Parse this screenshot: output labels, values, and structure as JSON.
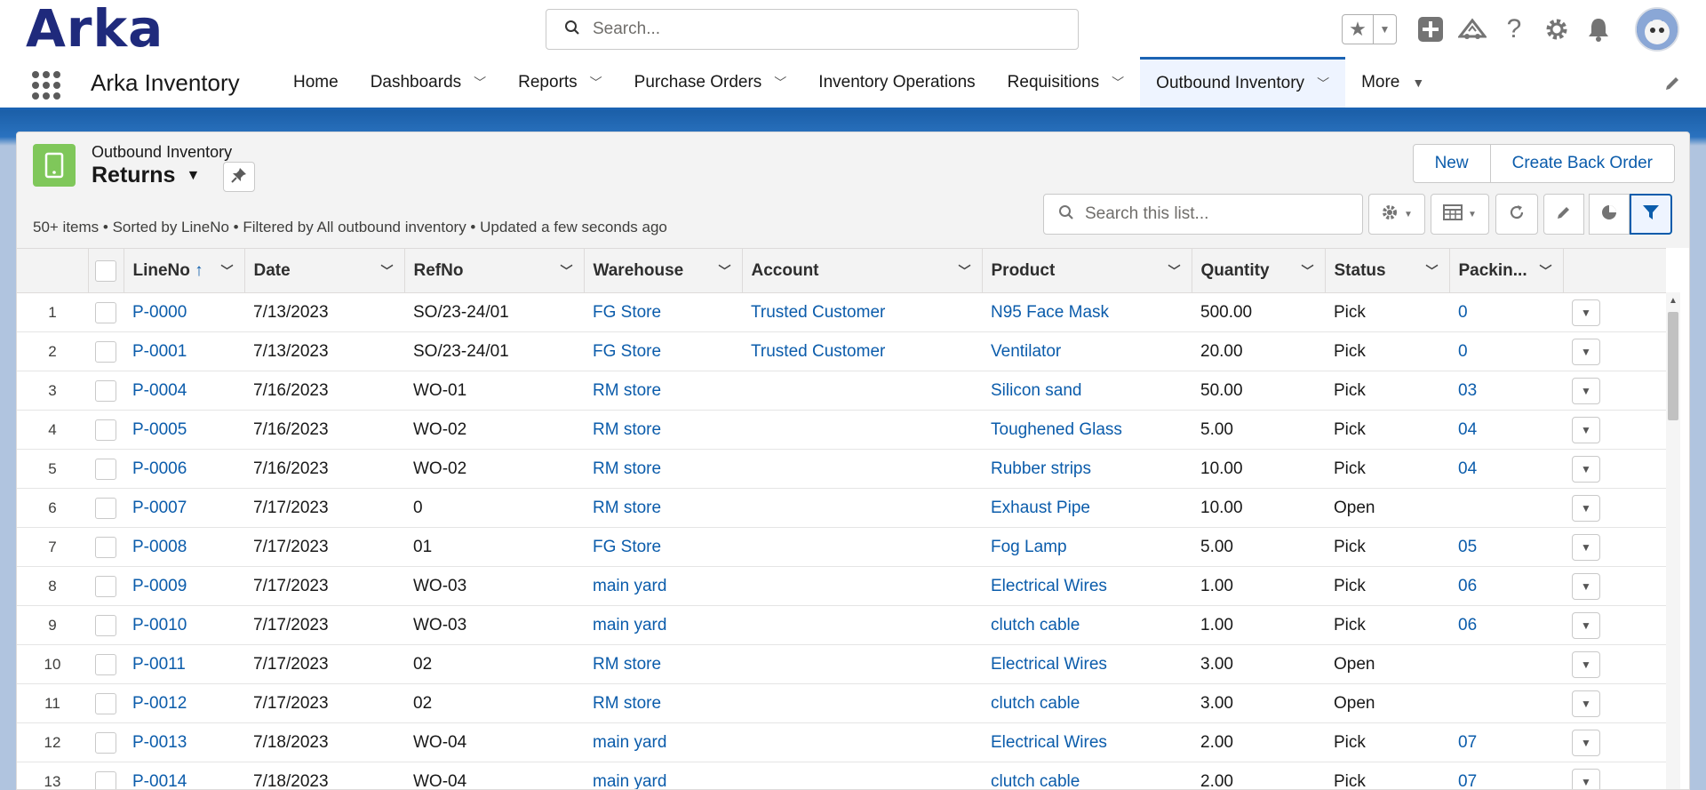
{
  "header": {
    "logo": "Arka",
    "search_placeholder": "Search..."
  },
  "nav": {
    "app_name": "Arka Inventory",
    "items": [
      {
        "label": "Home",
        "has_menu": false
      },
      {
        "label": "Dashboards",
        "has_menu": true
      },
      {
        "label": "Reports",
        "has_menu": true
      },
      {
        "label": "Purchase Orders",
        "has_menu": true
      },
      {
        "label": "Inventory Operations",
        "has_menu": false
      },
      {
        "label": "Requisitions",
        "has_menu": true
      },
      {
        "label": "Outbound Inventory",
        "has_menu": true,
        "active": true
      },
      {
        "label": "More",
        "has_menu": true
      }
    ]
  },
  "list": {
    "object_label": "Outbound Inventory",
    "view_name": "Returns",
    "buttons": {
      "new": "New",
      "back_order": "Create Back Order"
    },
    "summary": "50+ items • Sorted by LineNo • Filtered by All outbound inventory • Updated a few seconds ago",
    "search_placeholder": "Search this list..."
  },
  "table": {
    "columns": [
      "LineNo",
      "Date",
      "RefNo",
      "Warehouse",
      "Account",
      "Product",
      "Quantity",
      "Status",
      "Packin..."
    ],
    "sorted_indicator": "↑",
    "rows": [
      {
        "num": "1",
        "line": "P-0000",
        "date": "7/13/2023",
        "ref": "SO/23-24/01",
        "warehouse": "FG Store",
        "account": "Trusted Customer",
        "product": "N95 Face Mask",
        "qty": "500.00",
        "status": "Pick",
        "packing": "0"
      },
      {
        "num": "2",
        "line": "P-0001",
        "date": "7/13/2023",
        "ref": "SO/23-24/01",
        "warehouse": "FG Store",
        "account": "Trusted Customer",
        "product": "Ventilator",
        "qty": "20.00",
        "status": "Pick",
        "packing": "0"
      },
      {
        "num": "3",
        "line": "P-0004",
        "date": "7/16/2023",
        "ref": "WO-01",
        "warehouse": "RM store",
        "account": "",
        "product": "Silicon sand",
        "qty": "50.00",
        "status": "Pick",
        "packing": "03"
      },
      {
        "num": "4",
        "line": "P-0005",
        "date": "7/16/2023",
        "ref": "WO-02",
        "warehouse": "RM store",
        "account": "",
        "product": "Toughened Glass",
        "qty": "5.00",
        "status": "Pick",
        "packing": "04"
      },
      {
        "num": "5",
        "line": "P-0006",
        "date": "7/16/2023",
        "ref": "WO-02",
        "warehouse": "RM store",
        "account": "",
        "product": "Rubber strips",
        "qty": "10.00",
        "status": "Pick",
        "packing": "04"
      },
      {
        "num": "6",
        "line": "P-0007",
        "date": "7/17/2023",
        "ref": "0",
        "warehouse": "RM store",
        "account": "",
        "product": "Exhaust Pipe",
        "qty": "10.00",
        "status": "Open",
        "packing": ""
      },
      {
        "num": "7",
        "line": "P-0008",
        "date": "7/17/2023",
        "ref": "01",
        "warehouse": "FG Store",
        "account": "",
        "product": "Fog Lamp",
        "qty": "5.00",
        "status": "Pick",
        "packing": "05"
      },
      {
        "num": "8",
        "line": "P-0009",
        "date": "7/17/2023",
        "ref": "WO-03",
        "warehouse": "main yard",
        "account": "",
        "product": "Electrical Wires",
        "qty": "1.00",
        "status": "Pick",
        "packing": "06"
      },
      {
        "num": "9",
        "line": "P-0010",
        "date": "7/17/2023",
        "ref": "WO-03",
        "warehouse": "main yard",
        "account": "",
        "product": "clutch cable",
        "qty": "1.00",
        "status": "Pick",
        "packing": "06"
      },
      {
        "num": "10",
        "line": "P-0011",
        "date": "7/17/2023",
        "ref": "02",
        "warehouse": "RM store",
        "account": "",
        "product": "Electrical Wires",
        "qty": "3.00",
        "status": "Open",
        "packing": ""
      },
      {
        "num": "11",
        "line": "P-0012",
        "date": "7/17/2023",
        "ref": "02",
        "warehouse": "RM store",
        "account": "",
        "product": "clutch cable",
        "qty": "3.00",
        "status": "Open",
        "packing": ""
      },
      {
        "num": "12",
        "line": "P-0013",
        "date": "7/18/2023",
        "ref": "WO-04",
        "warehouse": "main yard",
        "account": "",
        "product": "Electrical Wires",
        "qty": "2.00",
        "status": "Pick",
        "packing": "07"
      },
      {
        "num": "13",
        "line": "P-0014",
        "date": "7/18/2023",
        "ref": "WO-04",
        "warehouse": "main yard",
        "account": "",
        "product": "clutch cable",
        "qty": "2.00",
        "status": "Pick",
        "packing": "07"
      }
    ]
  },
  "colors": {
    "brand_blue": "#1f2a7c",
    "link": "#0b5cab",
    "nav_accent": "#1b63b3",
    "object_icon": "#7fc75a"
  },
  "icons": [
    "search-icon",
    "star-icon",
    "add-icon",
    "trailhead-icon",
    "help-icon",
    "setup-gear-icon",
    "bell-icon",
    "app-launcher-icon",
    "pencil-icon",
    "tablet-icon",
    "pin-icon",
    "refresh-icon",
    "chart-icon",
    "filter-icon",
    "table-icon"
  ]
}
